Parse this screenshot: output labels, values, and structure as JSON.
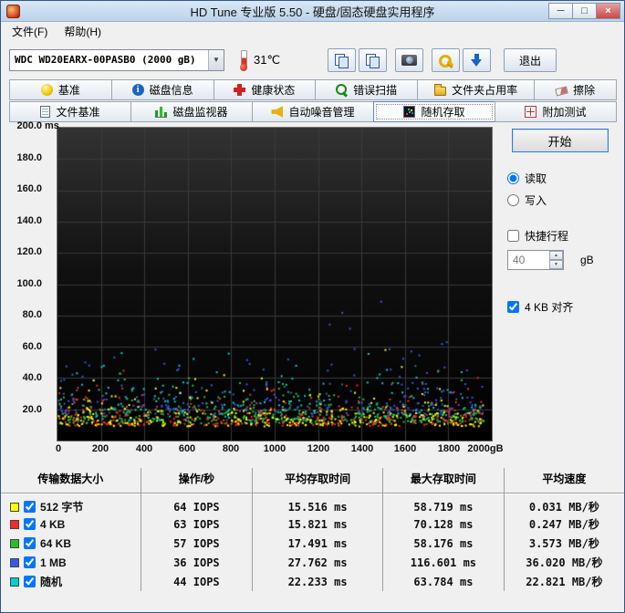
{
  "window": {
    "title": "HD Tune 专业版 5.50 - 硬盘/固态硬盘实用程序",
    "controls": {
      "minimize": "─",
      "maximize": "□",
      "close": "×"
    }
  },
  "menu": {
    "items": [
      {
        "label": "文件(F)"
      },
      {
        "label": "帮助(H)"
      }
    ]
  },
  "toolbar": {
    "drive_select": "WDC WD20EARX-00PASB0 (2000 gB)",
    "temperature": "31℃",
    "exit_label": "退出"
  },
  "icons": {
    "chevron_down": "▼",
    "spinner_up": "▲",
    "spinner_down": "▼"
  },
  "tabs": {
    "row1": [
      {
        "label": "基准",
        "icon": "bulb-icon"
      },
      {
        "label": "磁盘信息",
        "icon": "info-icon"
      },
      {
        "label": "健康状态",
        "icon": "health-cross-icon"
      },
      {
        "label": "错误扫描",
        "icon": "magnifier-icon"
      },
      {
        "label": "文件夹占用率",
        "icon": "folder-icon"
      },
      {
        "label": "擦除",
        "icon": "eraser-icon"
      }
    ],
    "row2": [
      {
        "label": "文件基准",
        "icon": "file-icon"
      },
      {
        "label": "磁盘监视器",
        "icon": "monitor-bars-icon"
      },
      {
        "label": "自动噪音管理",
        "icon": "speaker-icon"
      },
      {
        "label": "随机存取",
        "icon": "scatter-icon",
        "active": true
      },
      {
        "label": "附加测试",
        "icon": "grid-icon"
      }
    ]
  },
  "side_panel": {
    "start_label": "开始",
    "read_label": "读取",
    "write_label": "写入",
    "read_checked": "checked",
    "short_stroke_label": "快捷行程",
    "short_stroke_value": "40",
    "short_stroke_unit": "gB",
    "align_label": "4 KB 对齐",
    "align_checked": "checked"
  },
  "chart_data": {
    "type": "scatter",
    "title": "随机存取 — 存取时间散点图",
    "ylabel_unit": "ms",
    "x_axis_unit": "gB",
    "xlim": [
      0,
      2000
    ],
    "ylim": [
      0,
      200
    ],
    "x_grid_step": 200,
    "y_grid_step": 20,
    "grid": true,
    "legend_position": "table-below",
    "yticks": [
      "200.0",
      "180.0",
      "160.0",
      "140.0",
      "120.0",
      "100.0",
      "80.0",
      "60.0",
      "40.0",
      "20.0"
    ],
    "xticks": [
      "0",
      "200",
      "400",
      "600",
      "800",
      "1000",
      "1200",
      "1400",
      "1600",
      "1800",
      "2000gB"
    ],
    "extent_gb": 1960,
    "seed": 20130550,
    "series": [
      {
        "name": "512 字节",
        "color": "#ffff00",
        "count": 300,
        "base_ms": 9.0,
        "scale_ms": 6.5,
        "avg_ms": 15.516,
        "max_ms": 58.719
      },
      {
        "name": "4 KB",
        "color": "#ff2828",
        "count": 300,
        "base_ms": 9.3,
        "scale_ms": 6.5,
        "avg_ms": 15.821,
        "max_ms": 70.128
      },
      {
        "name": "64 KB",
        "color": "#28c028",
        "count": 280,
        "base_ms": 10.5,
        "scale_ms": 7.0,
        "avg_ms": 17.491,
        "max_ms": 58.176
      },
      {
        "name": "1 MB",
        "color": "#3858e0",
        "count": 250,
        "base_ms": 17.0,
        "scale_ms": 10.8,
        "avg_ms": 27.762,
        "max_ms": 116.601
      },
      {
        "name": "随机",
        "color": "#00d0d0",
        "count": 270,
        "base_ms": 12.5,
        "scale_ms": 9.7,
        "avg_ms": 22.233,
        "max_ms": 63.784
      }
    ]
  },
  "table": {
    "headers": [
      "传输数据大小",
      "操作/秒",
      "平均存取时间",
      "最大存取时间",
      "平均速度"
    ],
    "rows": [
      {
        "color": "#ffff00",
        "checked": "checked",
        "label": "512 字节",
        "iops": "64 IOPS",
        "avg": "15.516 ms",
        "max": "58.719 ms",
        "speed": "0.031 MB/秒"
      },
      {
        "color": "#ff2828",
        "checked": "checked",
        "label": "4 KB",
        "iops": "63 IOPS",
        "avg": "15.821 ms",
        "max": "70.128 ms",
        "speed": "0.247 MB/秒"
      },
      {
        "color": "#28c028",
        "checked": "checked",
        "label": "64 KB",
        "iops": "57 IOPS",
        "avg": "17.491 ms",
        "max": "58.176 ms",
        "speed": "3.573 MB/秒"
      },
      {
        "color": "#3858e0",
        "checked": "checked",
        "label": "1 MB",
        "iops": "36 IOPS",
        "avg": "27.762 ms",
        "max": "116.601 ms",
        "speed": "36.020 MB/秒"
      },
      {
        "color": "#00d0d0",
        "checked": "checked",
        "label": "随机",
        "iops": "44 IOPS",
        "avg": "22.233 ms",
        "max": "63.784 ms",
        "speed": "22.821 MB/秒"
      }
    ]
  }
}
